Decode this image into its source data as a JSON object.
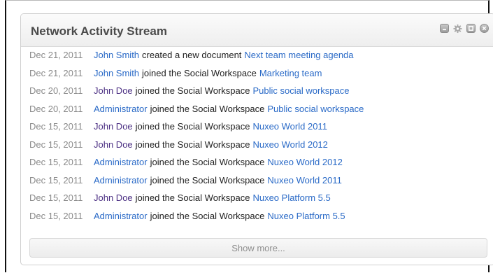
{
  "widget": {
    "title": "Network Activity Stream",
    "icons": [
      "minimize-icon",
      "gear-icon",
      "maximize-icon",
      "close-icon"
    ]
  },
  "activities": [
    {
      "date": "Dec 21, 2011",
      "actor": "John Smith",
      "verb": "created a new document",
      "target": "Next team meeting agenda",
      "actor_visited": false
    },
    {
      "date": "Dec 21, 2011",
      "actor": "John Smith",
      "verb": "joined the Social Workspace",
      "target": "Marketing team",
      "actor_visited": false
    },
    {
      "date": "Dec 20, 2011",
      "actor": "John Doe",
      "verb": "joined the Social Workspace",
      "target": "Public social workspace",
      "actor_visited": true
    },
    {
      "date": "Dec 20, 2011",
      "actor": "Administrator",
      "verb": "joined the Social Workspace",
      "target": "Public social workspace",
      "actor_visited": false
    },
    {
      "date": "Dec 15, 2011",
      "actor": "John Doe",
      "verb": "joined the Social Workspace",
      "target": "Nuxeo World 2011",
      "actor_visited": true
    },
    {
      "date": "Dec 15, 2011",
      "actor": "John Doe",
      "verb": "joined the Social Workspace",
      "target": "Nuxeo World 2012",
      "actor_visited": true
    },
    {
      "date": "Dec 15, 2011",
      "actor": "Administrator",
      "verb": "joined the Social Workspace",
      "target": "Nuxeo World 2012",
      "actor_visited": false
    },
    {
      "date": "Dec 15, 2011",
      "actor": "Administrator",
      "verb": "joined the Social Workspace",
      "target": "Nuxeo World 2011",
      "actor_visited": false
    },
    {
      "date": "Dec 15, 2011",
      "actor": "John Doe",
      "verb": "joined the Social Workspace",
      "target": "Nuxeo Platform 5.5",
      "actor_visited": true
    },
    {
      "date": "Dec 15, 2011",
      "actor": "Administrator",
      "verb": "joined the Social Workspace",
      "target": "Nuxeo Platform 5.5",
      "actor_visited": false
    }
  ],
  "show_more_label": "Show more...",
  "colors": {
    "link": "#2a6ac7",
    "visited_link": "#4b2f83",
    "date": "#8a8a8a",
    "title": "#4a4a4a"
  }
}
